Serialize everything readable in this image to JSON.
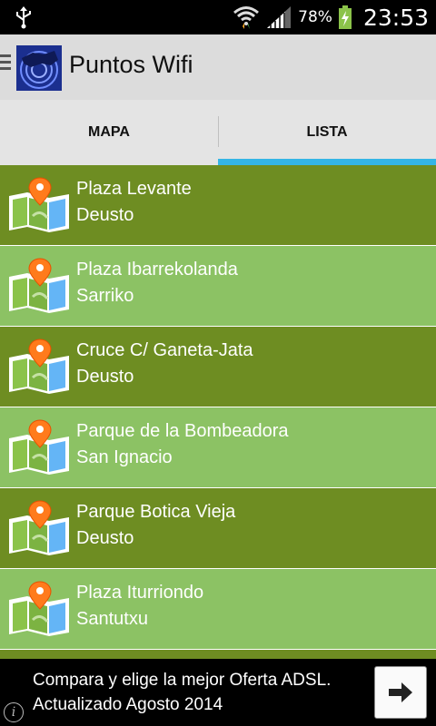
{
  "status_bar": {
    "battery_percent": "78%",
    "time": "23:53"
  },
  "app": {
    "title": "Puntos Wifi"
  },
  "tabs": [
    {
      "label": "MAPA",
      "active": false
    },
    {
      "label": "LISTA",
      "active": true
    }
  ],
  "list": [
    {
      "name": "Plaza Levante",
      "district": "Deusto",
      "style": "dark"
    },
    {
      "name": "Plaza Ibarrekolanda",
      "district": "Sarriko",
      "style": "light"
    },
    {
      "name": "Cruce C/ Ganeta-Jata",
      "district": "Deusto",
      "style": "dark"
    },
    {
      "name": "Parque de la Bombeadora",
      "district": "San Ignacio",
      "style": "light"
    },
    {
      "name": "Parque Botica Vieja",
      "district": "Deusto",
      "style": "dark"
    },
    {
      "name": "Plaza Iturriondo",
      "district": "Santutxu",
      "style": "light"
    }
  ],
  "ad": {
    "line1": "Compara y elige la mejor Oferta ADSL.",
    "line2": "Actualizado Agosto 2014",
    "info_icon": "i"
  },
  "colors": {
    "row_dark": "#6e8d22",
    "row_light": "#8cc264",
    "tab_indicator": "#34b5e5"
  }
}
